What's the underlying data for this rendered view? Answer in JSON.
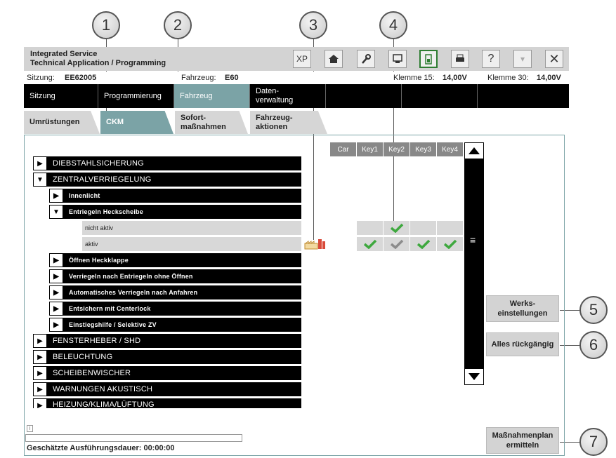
{
  "callouts": [
    "1",
    "2",
    "3",
    "4",
    "5",
    "6",
    "7"
  ],
  "header": {
    "title_line1": "Integrated Service",
    "title_line2": "Technical Application / Programming",
    "icons": [
      "XP",
      "home-icon",
      "wrench-icon",
      "module-icon",
      "battery-icon",
      "printer-icon",
      "help-icon",
      "dropdown-icon",
      "close-icon"
    ],
    "xp": "XP",
    "help": "?"
  },
  "status": {
    "session_label": "Sitzung:",
    "session_value": "EE62005",
    "vehicle_label": "Fahrzeug:",
    "vehicle_value": "E60",
    "klemme15_label": "Klemme 15:",
    "klemme15_value": "14,00V",
    "klemme30_label": "Klemme 30:",
    "klemme30_value": "14,00V"
  },
  "main_tabs": [
    "Sitzung",
    "Programmierung",
    "Fahrzeug",
    "Daten-\nverwaltung"
  ],
  "sub_tabs": [
    "Umrüstungen",
    "CKM",
    "Sofort-\nmaßnahmen",
    "Fahrzeug-\naktionen"
  ],
  "tree": {
    "diebstahl": "DIEBSTAHLSICHERUNG",
    "zentral": "ZENTRALVERRIEGELUNG",
    "innenlicht": "Innenlicht",
    "entriegeln": "Entriegeln Heckscheibe",
    "opt_nicht": "nicht aktiv",
    "opt_aktiv": "aktiv",
    "oeffnen": "Öffnen Heckklappe",
    "verriegeln": "Verriegeln nach Entriegeln ohne Öffnen",
    "auto": "Automatisches Verriegeln nach Anfahren",
    "entsichern": "Entsichern mit Centerlock",
    "einstieg": "Einstiegshilfe / Selektive ZV",
    "fenster": "FENSTERHEBER / SHD",
    "beleuchtung": "BELEUCHTUNG",
    "scheiben": "SCHEIBENWISCHER",
    "warnungen": "WARNUNGEN AKUSTISCH",
    "heizung": "HEIZUNG/KLIMA/LÜFTUNG"
  },
  "keys": [
    "Car",
    "Key1",
    "Key2",
    "Key3",
    "Key4"
  ],
  "selection": {
    "nicht_aktiv": [
      false,
      false,
      true,
      false,
      false
    ],
    "aktiv": [
      false,
      true,
      "grey",
      true,
      true
    ]
  },
  "buttons": {
    "werks": "Werks-\neinstellungen",
    "alles": "Alles rückgängig",
    "plan": "Maßnahmenplan\nermitteln"
  },
  "footer": {
    "info": "i",
    "duration": "Geschätzte Ausführungsdauer: 00:00:00"
  },
  "colors": {
    "accent": "#7ba3a6",
    "check_green": "#3ea83e",
    "check_grey": "#8c8c8c"
  }
}
